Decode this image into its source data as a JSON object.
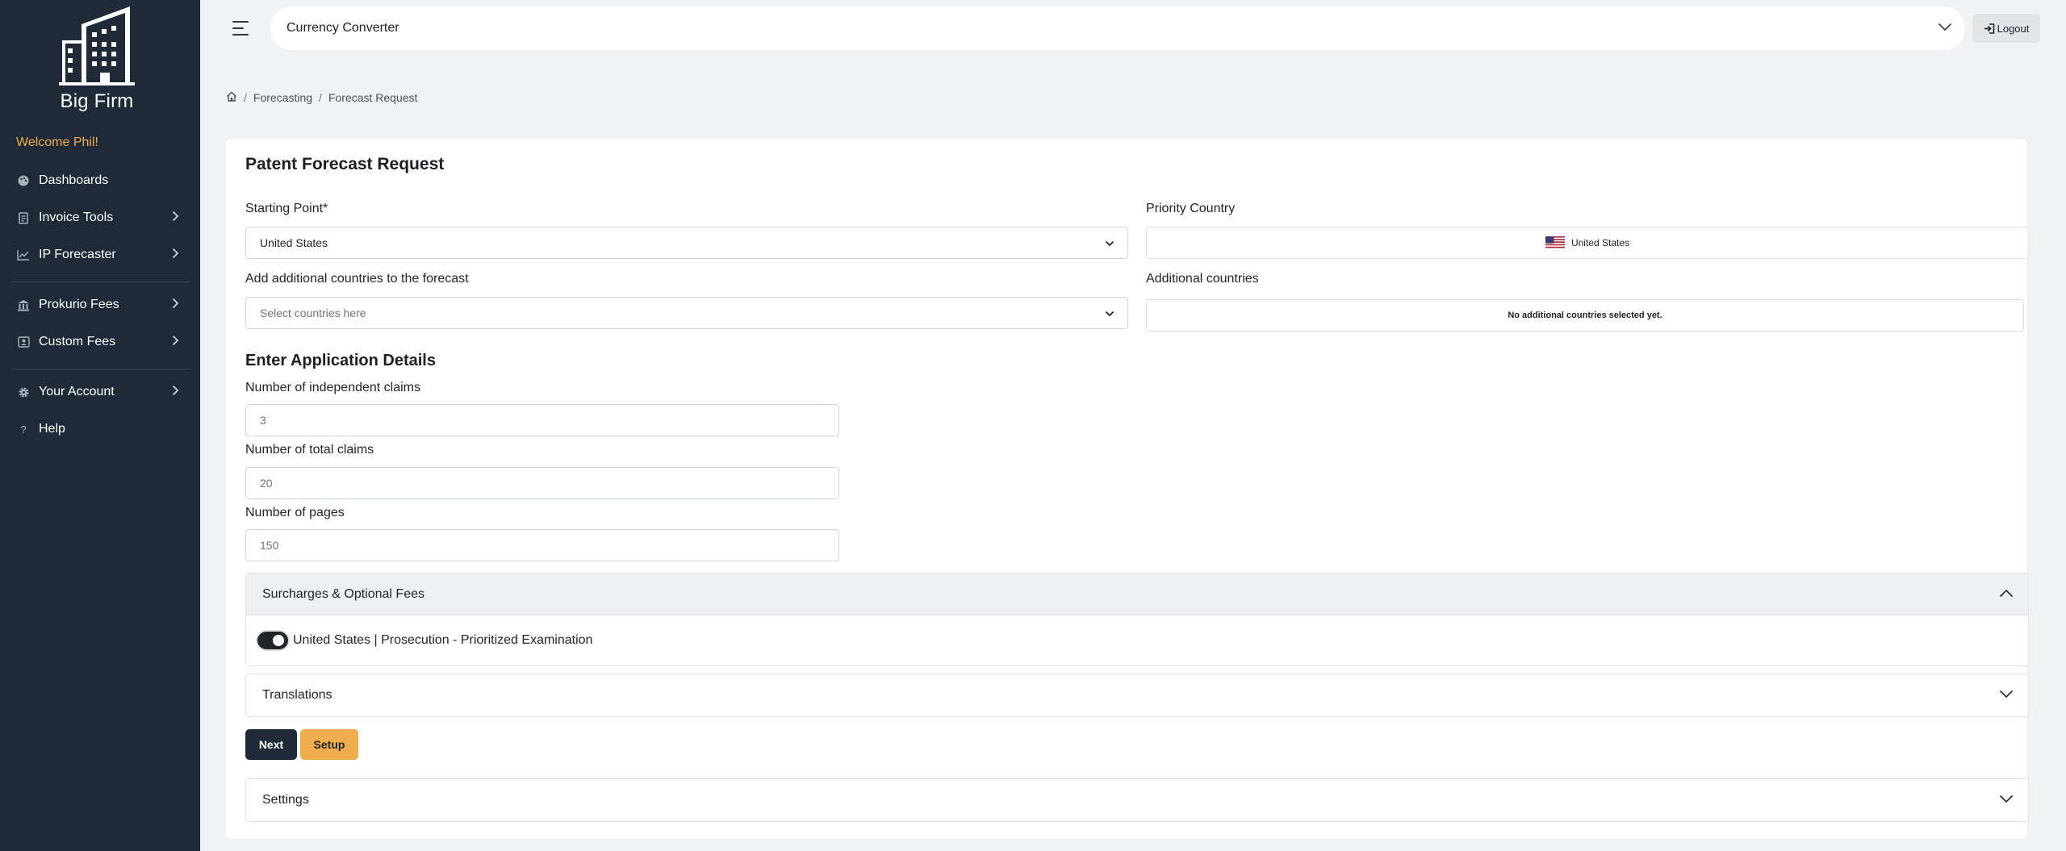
{
  "sidebar": {
    "brand_name": "Big Firm",
    "welcome": "Welcome Phil!",
    "items": [
      {
        "label": "Dashboards",
        "icon": "palette-icon",
        "has_children": false
      },
      {
        "label": "Invoice Tools",
        "icon": "receipt-icon",
        "has_children": true
      },
      {
        "label": "IP Forecaster",
        "icon": "chart-line-icon",
        "has_children": true
      },
      {
        "label": "Prokurio Fees",
        "icon": "bank-icon",
        "has_children": true
      },
      {
        "label": "Custom Fees",
        "icon": "person-badge-icon",
        "has_children": true
      },
      {
        "label": "Your Account",
        "icon": "gear-icon",
        "has_children": true
      },
      {
        "label": "Help",
        "icon": "question-icon",
        "has_children": false
      }
    ],
    "accent_color": "#f0ad4e",
    "background": "#1f2937"
  },
  "topbar": {
    "title": "Currency Converter",
    "logout_label": "Logout"
  },
  "breadcrumb": {
    "items": [
      "Forecasting",
      "Forecast Request"
    ]
  },
  "form": {
    "title": "Patent Forecast Request",
    "starting_point": {
      "label": "Starting Point*",
      "value": "United States"
    },
    "priority_country": {
      "label": "Priority Country",
      "value": "United States"
    },
    "additional_select": {
      "label": "Add additional countries to the forecast",
      "placeholder": "Select countries here"
    },
    "additional_countries": {
      "label": "Additional countries",
      "empty_text": "No additional countries selected yet."
    },
    "section_title": "Enter Application Details",
    "independent_claims": {
      "label": "Number of independent claims",
      "value": "3"
    },
    "total_claims": {
      "label": "Number of total claims",
      "value": "20"
    },
    "pages": {
      "label": "Number of pages",
      "value": "150"
    },
    "surcharges": {
      "title": "Surcharges & Optional Fees",
      "options": [
        {
          "label": "United States | Prosecution - Prioritized Examination",
          "enabled": true
        }
      ]
    },
    "translations_title": "Translations",
    "next_label": "Next",
    "setup_label": "Setup",
    "settings_title": "Settings"
  }
}
